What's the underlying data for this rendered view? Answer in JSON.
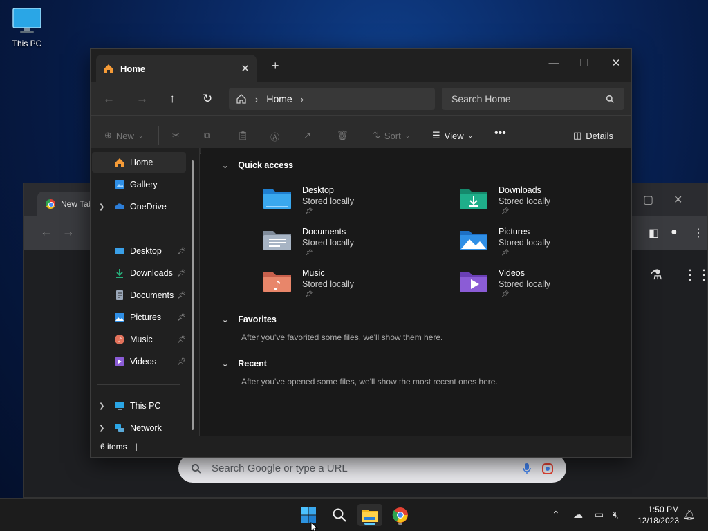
{
  "desktop": {
    "icons": [
      {
        "label": "This PC",
        "icon": "monitor-icon"
      }
    ]
  },
  "chrome": {
    "tab_title": "New Tab",
    "search_placeholder": "Search Google or type a URL"
  },
  "explorer": {
    "tab_title": "Home",
    "breadcrumb": [
      "Home"
    ],
    "search_placeholder": "Search Home",
    "commands": {
      "new": "New",
      "sort": "Sort",
      "view": "View",
      "details": "Details"
    },
    "nav": {
      "top": [
        {
          "label": "Home",
          "icon": "home-icon",
          "color": "#f59b37",
          "selected": true
        },
        {
          "label": "Gallery",
          "icon": "gallery-icon",
          "color": "#2f8fe6"
        },
        {
          "label": "OneDrive",
          "icon": "cloud-icon",
          "color": "#2d7ed8",
          "expandable": true
        }
      ],
      "pinned": [
        {
          "label": "Desktop",
          "icon": "desktop-folder-icon",
          "color": "#3aa0e8"
        },
        {
          "label": "Downloads",
          "icon": "download-icon",
          "color": "#27ae7a"
        },
        {
          "label": "Documents",
          "icon": "document-icon",
          "color": "#9aa7b8"
        },
        {
          "label": "Pictures",
          "icon": "pictures-icon",
          "color": "#2f8fe6"
        },
        {
          "label": "Music",
          "icon": "music-icon",
          "color": "#e2725b"
        },
        {
          "label": "Videos",
          "icon": "videos-icon",
          "color": "#8b5cd6"
        }
      ],
      "bottom": [
        {
          "label": "This PC",
          "icon": "pc-icon",
          "expandable": true
        },
        {
          "label": "Network",
          "icon": "network-icon",
          "expandable": true
        }
      ]
    },
    "sections": {
      "quick_access": "Quick access",
      "favorites": "Favorites",
      "favorites_msg": "After you've favorited some files, we'll show them here.",
      "recent": "Recent",
      "recent_msg": "After you've opened some files, we'll show the most recent ones here."
    },
    "quick_access_items": [
      {
        "name": "Desktop",
        "sub": "Stored locally",
        "icon": "desktop-folder-icon",
        "color": "#3aa0e8"
      },
      {
        "name": "Downloads",
        "sub": "Stored locally",
        "icon": "downloads-folder-icon",
        "color": "#1fae8a"
      },
      {
        "name": "Documents",
        "sub": "Stored locally",
        "icon": "documents-folder-icon",
        "color": "#a7b4c4"
      },
      {
        "name": "Pictures",
        "sub": "Stored locally",
        "icon": "pictures-folder-icon",
        "color": "#2f8fe6"
      },
      {
        "name": "Music",
        "sub": "Stored locally",
        "icon": "music-folder-icon",
        "color": "#e8866a"
      },
      {
        "name": "Videos",
        "sub": "Stored locally",
        "icon": "videos-folder-icon",
        "color": "#8b5cd6"
      }
    ],
    "status": "6 items"
  },
  "taskbar": {
    "time": "1:50 PM",
    "date": "12/18/2023"
  }
}
